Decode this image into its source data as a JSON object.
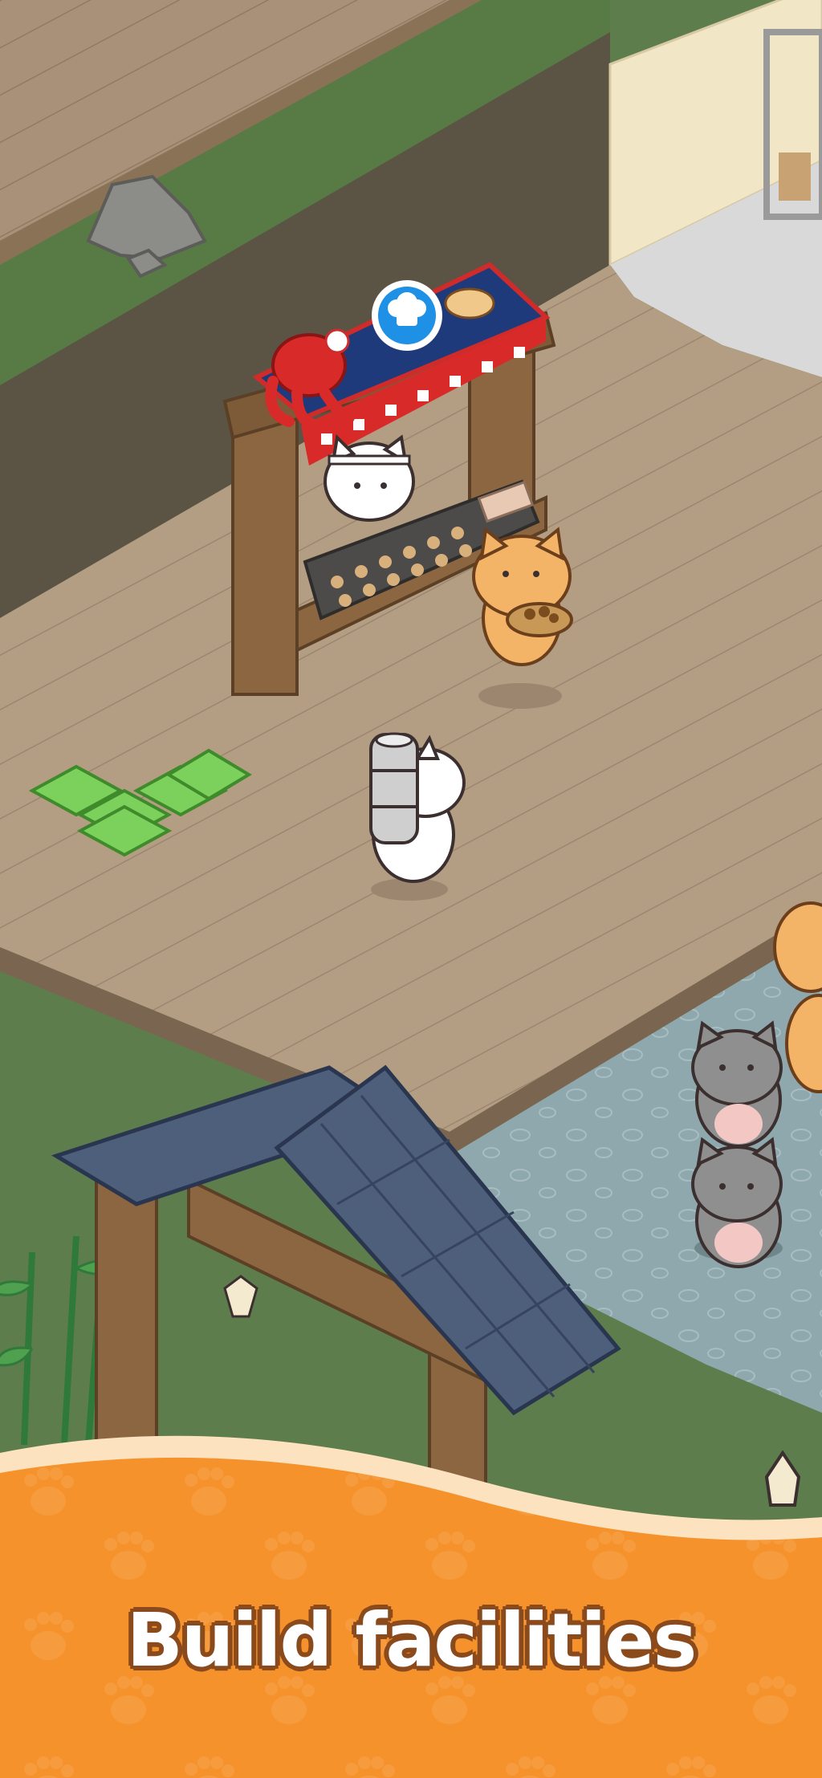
{
  "caption": "Build facilities",
  "icons": {
    "chef_badge": "chef-hat-icon",
    "money": "cash-bill-icon"
  },
  "colors": {
    "deck": "#b29c82",
    "grass": "#5e7d4c",
    "wall": "#5e5648",
    "water": "#8fa9ae",
    "roof": "#4d5f7a",
    "banner_orange": "#f5922b",
    "banner_cream": "#fde2c0",
    "caption_outline": "#8a4a1c",
    "money_green": "#7bd15c",
    "badge_blue": "#1e90e6"
  }
}
